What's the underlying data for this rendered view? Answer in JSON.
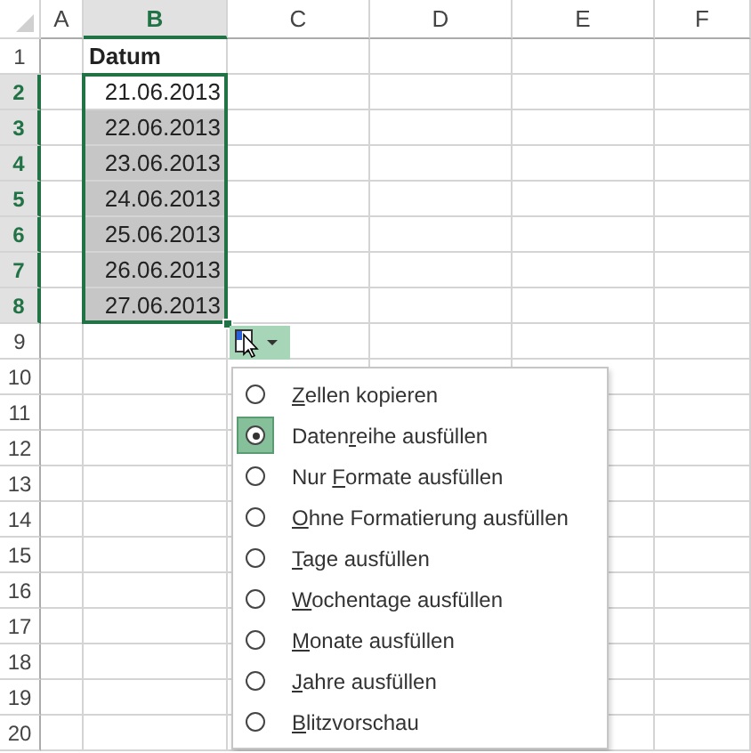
{
  "columns": [
    {
      "label": "A",
      "selected": false
    },
    {
      "label": "B",
      "selected": true
    },
    {
      "label": "C",
      "selected": false
    },
    {
      "label": "D",
      "selected": false
    },
    {
      "label": "E",
      "selected": false
    },
    {
      "label": "F",
      "selected": false
    }
  ],
  "rows": [
    {
      "label": "1",
      "selected": false,
      "b": {
        "text": "Datum",
        "kind": "heading",
        "shaded": false
      }
    },
    {
      "label": "2",
      "selected": true,
      "b": {
        "text": "21.06.2013",
        "kind": "date",
        "shaded": false
      }
    },
    {
      "label": "3",
      "selected": true,
      "b": {
        "text": "22.06.2013",
        "kind": "date",
        "shaded": true
      }
    },
    {
      "label": "4",
      "selected": true,
      "b": {
        "text": "23.06.2013",
        "kind": "date",
        "shaded": true
      }
    },
    {
      "label": "5",
      "selected": true,
      "b": {
        "text": "24.06.2013",
        "kind": "date",
        "shaded": true
      }
    },
    {
      "label": "6",
      "selected": true,
      "b": {
        "text": "25.06.2013",
        "kind": "date",
        "shaded": true
      }
    },
    {
      "label": "7",
      "selected": true,
      "b": {
        "text": "26.06.2013",
        "kind": "date",
        "shaded": true
      }
    },
    {
      "label": "8",
      "selected": true,
      "b": {
        "text": "27.06.2013",
        "kind": "date",
        "shaded": true
      }
    },
    {
      "label": "9",
      "selected": false
    },
    {
      "label": "10",
      "selected": false
    },
    {
      "label": "11",
      "selected": false
    },
    {
      "label": "12",
      "selected": false
    },
    {
      "label": "13",
      "selected": false
    },
    {
      "label": "14",
      "selected": false
    },
    {
      "label": "15",
      "selected": false
    },
    {
      "label": "16",
      "selected": false
    },
    {
      "label": "17",
      "selected": false
    },
    {
      "label": "18",
      "selected": false
    },
    {
      "label": "19",
      "selected": false
    },
    {
      "label": "20",
      "selected": false
    }
  ],
  "autofill_menu": {
    "options": [
      {
        "key": "Z",
        "after": "ellen kopieren",
        "selected": false
      },
      {
        "before": "Daten",
        "key": "r",
        "after": "eihe ausfüllen",
        "selected": true
      },
      {
        "before": "Nur ",
        "key": "F",
        "after": "ormate ausfüllen",
        "selected": false
      },
      {
        "key": "O",
        "after": "hne Formatierung ausfüllen",
        "selected": false
      },
      {
        "key": "T",
        "after": "age ausfüllen",
        "selected": false
      },
      {
        "key": "W",
        "after": "ochentage ausfüllen",
        "selected": false
      },
      {
        "key": "M",
        "after": "onate ausfüllen",
        "selected": false
      },
      {
        "key": "J",
        "after": "ahre ausfüllen",
        "selected": false
      },
      {
        "key": "B",
        "after": "litzvorschau",
        "selected": false
      }
    ]
  }
}
